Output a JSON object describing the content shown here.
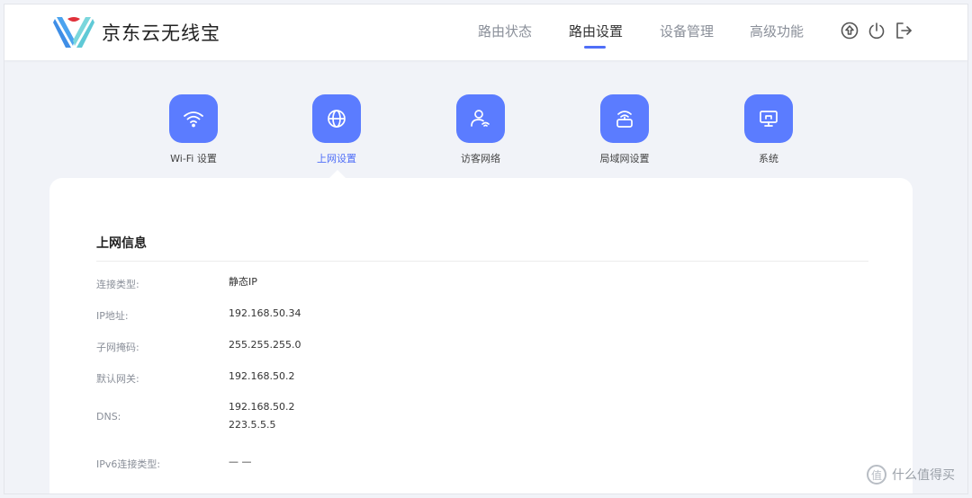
{
  "header": {
    "brand": "京东云无线宝",
    "nav": [
      {
        "label": "路由状态",
        "active": false
      },
      {
        "label": "路由设置",
        "active": true
      },
      {
        "label": "设备管理",
        "active": false
      },
      {
        "label": "高级功能",
        "active": false
      }
    ],
    "icons": [
      "upgrade-icon",
      "power-icon",
      "logout-icon"
    ],
    "accent": "#4f6ef7"
  },
  "categories": [
    {
      "label": "Wi-Fi 设置",
      "icon": "wifi-icon",
      "active": false
    },
    {
      "label": "上网设置",
      "icon": "globe-icon",
      "active": true
    },
    {
      "label": "访客网络",
      "icon": "guest-icon",
      "active": false
    },
    {
      "label": "局域网设置",
      "icon": "router-icon",
      "active": false
    },
    {
      "label": "系统",
      "icon": "monitor-icon",
      "active": false
    }
  ],
  "section": {
    "title": "上网信息",
    "rows": [
      {
        "key": "连接类型:",
        "value": "静态IP"
      },
      {
        "key": "IP地址:",
        "value": "192.168.50.34"
      },
      {
        "key": "子网掩码:",
        "value": "255.255.255.0"
      },
      {
        "key": "默认网关:",
        "value": "192.168.50.2"
      },
      {
        "key": "DNS:",
        "value": "192.168.50.2",
        "value2": "223.5.5.5"
      },
      {
        "key": "IPv6连接类型:",
        "value": "— —"
      }
    ]
  },
  "watermark": {
    "glyph": "值",
    "text": "什么值得买"
  },
  "colors": {
    "icon_bg": "#5b7cff",
    "page_bg": "#f1f3f8"
  }
}
